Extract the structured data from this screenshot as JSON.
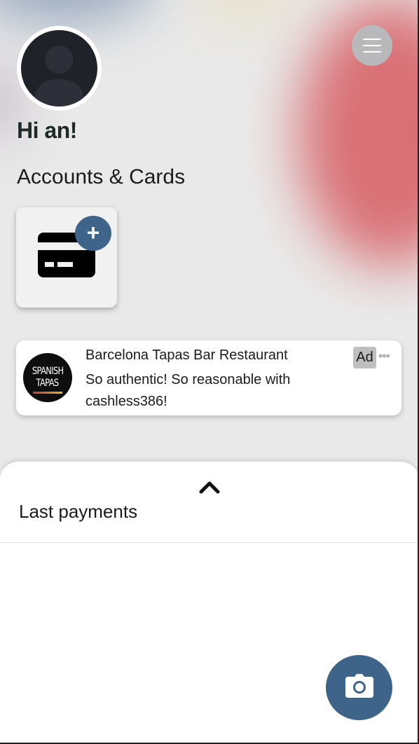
{
  "user": {
    "greeting": "Hi an!"
  },
  "accounts": {
    "section_title": "Accounts & Cards",
    "add_card_icon": "credit-card-icon",
    "add_badge_symbol": "+"
  },
  "ad": {
    "logo_text_line1": "SPANISH",
    "logo_text_line2": "TAPAS",
    "title": "Barcelona Tapas Bar Restaurant",
    "description": "So authentic! So reasonable with cashless386!",
    "badge": "Ad",
    "more_symbol": "•••"
  },
  "payments": {
    "title": "Last payments"
  },
  "icons": {
    "menu": "hamburger-menu-icon",
    "expand": "chevron-up-icon",
    "camera": "camera-icon",
    "avatar": "user-silhouette-icon"
  },
  "colors": {
    "accent": "#3f6489",
    "menu_button": "#b9b9bb",
    "background": "#e9e9e9"
  }
}
